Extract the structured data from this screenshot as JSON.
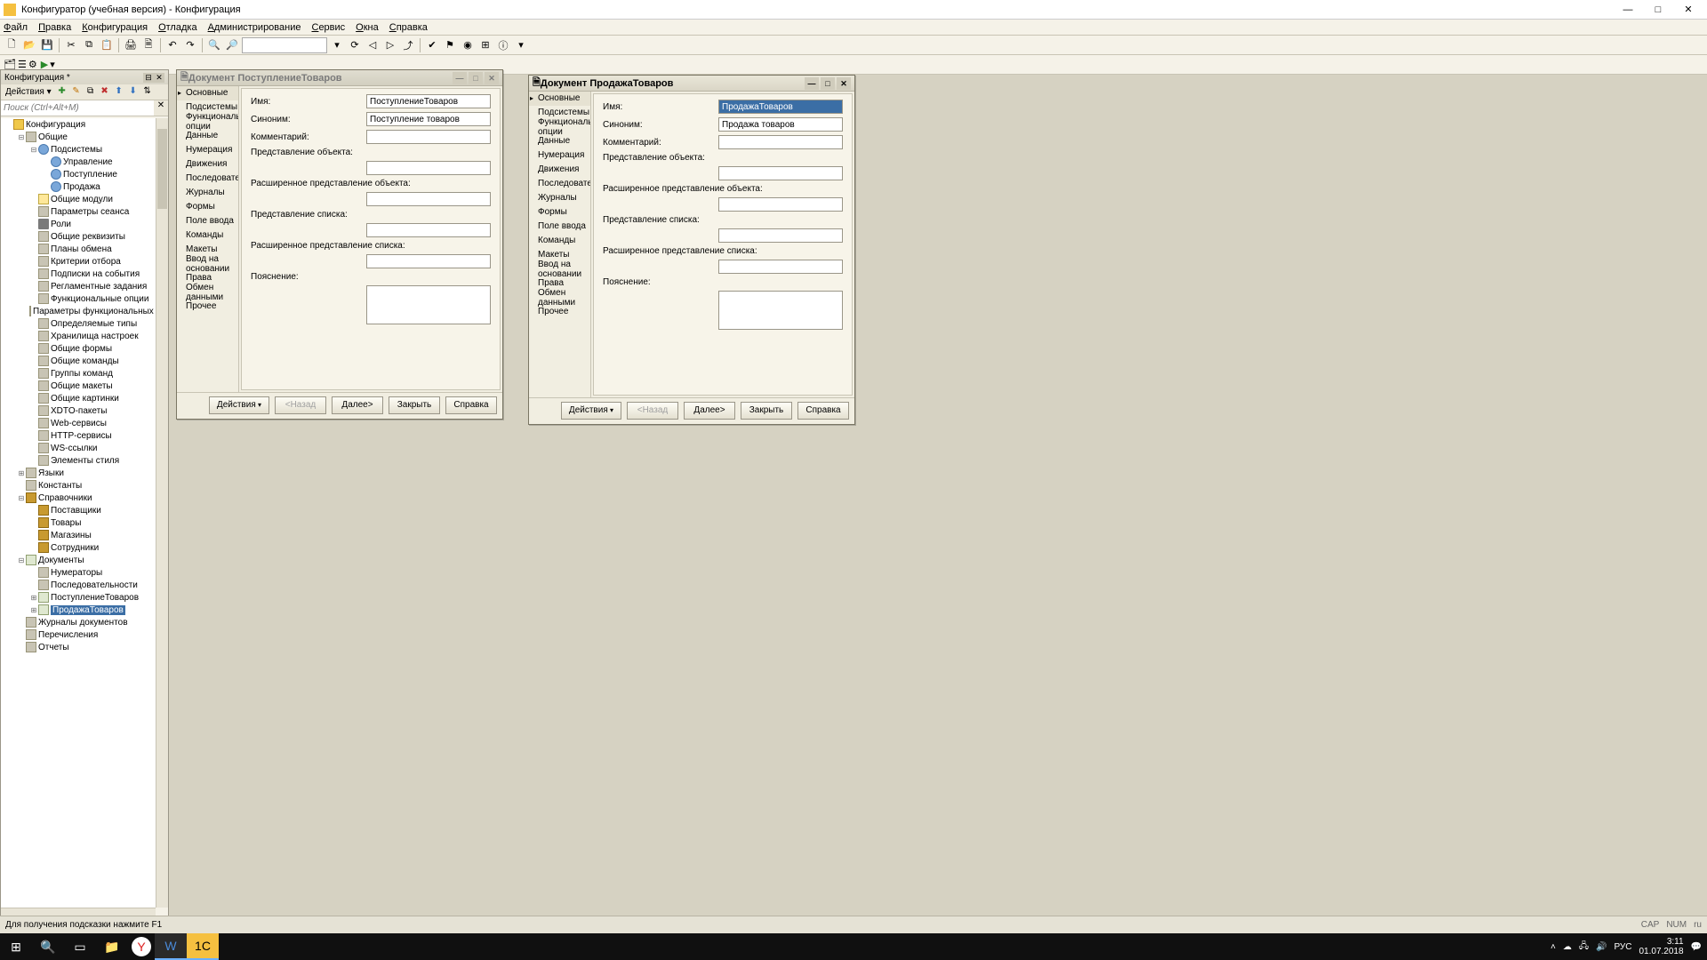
{
  "window": {
    "title": "Конфигуратор (учебная версия) - Конфигурация"
  },
  "menu": [
    "Файл",
    "Правка",
    "Конфигурация",
    "Отладка",
    "Администрирование",
    "Сервис",
    "Окна",
    "Справка"
  ],
  "tree_panel": {
    "title": "Конфигурация *",
    "actions_label": "Действия ▾",
    "search_placeholder": "Поиск (Ctrl+Alt+M)",
    "nodes": [
      {
        "d": 0,
        "exp": "",
        "ic": "ic-folder",
        "t": "Конфигурация"
      },
      {
        "d": 1,
        "exp": "⊟",
        "ic": "ic-gen",
        "t": "Общие"
      },
      {
        "d": 2,
        "exp": "⊟",
        "ic": "ic-sub",
        "t": "Подсистемы"
      },
      {
        "d": 3,
        "exp": "",
        "ic": "ic-sub",
        "t": "Управление"
      },
      {
        "d": 3,
        "exp": "",
        "ic": "ic-sub",
        "t": "Поступление"
      },
      {
        "d": 3,
        "exp": "",
        "ic": "ic-sub",
        "t": "Продажа"
      },
      {
        "d": 2,
        "exp": "",
        "ic": "ic-mod",
        "t": "Общие модули"
      },
      {
        "d": 2,
        "exp": "",
        "ic": "ic-gen",
        "t": "Параметры сеанса"
      },
      {
        "d": 2,
        "exp": "",
        "ic": "ic-role",
        "t": "Роли"
      },
      {
        "d": 2,
        "exp": "",
        "ic": "ic-gen",
        "t": "Общие реквизиты"
      },
      {
        "d": 2,
        "exp": "",
        "ic": "ic-gen",
        "t": "Планы обмена"
      },
      {
        "d": 2,
        "exp": "",
        "ic": "ic-gen",
        "t": "Критерии отбора"
      },
      {
        "d": 2,
        "exp": "",
        "ic": "ic-gen",
        "t": "Подписки на события"
      },
      {
        "d": 2,
        "exp": "",
        "ic": "ic-gen",
        "t": "Регламентные задания"
      },
      {
        "d": 2,
        "exp": "",
        "ic": "ic-gen",
        "t": "Функциональные опции"
      },
      {
        "d": 2,
        "exp": "",
        "ic": "ic-gen",
        "t": "Параметры функциональных опц"
      },
      {
        "d": 2,
        "exp": "",
        "ic": "ic-gen",
        "t": "Определяемые типы"
      },
      {
        "d": 2,
        "exp": "",
        "ic": "ic-gen",
        "t": "Хранилища настроек"
      },
      {
        "d": 2,
        "exp": "",
        "ic": "ic-gen",
        "t": "Общие формы"
      },
      {
        "d": 2,
        "exp": "",
        "ic": "ic-gen",
        "t": "Общие команды"
      },
      {
        "d": 2,
        "exp": "",
        "ic": "ic-gen",
        "t": "Группы команд"
      },
      {
        "d": 2,
        "exp": "",
        "ic": "ic-gen",
        "t": "Общие макеты"
      },
      {
        "d": 2,
        "exp": "",
        "ic": "ic-gen",
        "t": "Общие картинки"
      },
      {
        "d": 2,
        "exp": "",
        "ic": "ic-gen",
        "t": "XDTO-пакеты"
      },
      {
        "d": 2,
        "exp": "",
        "ic": "ic-gen",
        "t": "Web-сервисы"
      },
      {
        "d": 2,
        "exp": "",
        "ic": "ic-gen",
        "t": "HTTP-сервисы"
      },
      {
        "d": 2,
        "exp": "",
        "ic": "ic-gen",
        "t": "WS-ссылки"
      },
      {
        "d": 2,
        "exp": "",
        "ic": "ic-gen",
        "t": "Элементы стиля"
      },
      {
        "d": 1,
        "exp": "⊞",
        "ic": "ic-gen",
        "t": "Языки"
      },
      {
        "d": 1,
        "exp": "",
        "ic": "ic-gen",
        "t": "Константы"
      },
      {
        "d": 1,
        "exp": "⊟",
        "ic": "ic-cat",
        "t": "Справочники"
      },
      {
        "d": 2,
        "exp": "",
        "ic": "ic-cat",
        "t": "Поставщики"
      },
      {
        "d": 2,
        "exp": "",
        "ic": "ic-cat",
        "t": "Товары"
      },
      {
        "d": 2,
        "exp": "",
        "ic": "ic-cat",
        "t": "Магазины"
      },
      {
        "d": 2,
        "exp": "",
        "ic": "ic-cat",
        "t": "Сотрудники"
      },
      {
        "d": 1,
        "exp": "⊟",
        "ic": "ic-doc",
        "t": "Документы"
      },
      {
        "d": 2,
        "exp": "",
        "ic": "ic-gen",
        "t": "Нумераторы"
      },
      {
        "d": 2,
        "exp": "",
        "ic": "ic-gen",
        "t": "Последовательности"
      },
      {
        "d": 2,
        "exp": "⊞",
        "ic": "ic-doc",
        "t": "ПоступлениеТоваров"
      },
      {
        "d": 2,
        "exp": "⊞",
        "ic": "ic-doc",
        "t": "ПродажаТоваров",
        "sel": true
      },
      {
        "d": 1,
        "exp": "",
        "ic": "ic-gen",
        "t": "Журналы документов"
      },
      {
        "d": 1,
        "exp": "",
        "ic": "ic-gen",
        "t": "Перечисления"
      },
      {
        "d": 1,
        "exp": "",
        "ic": "ic-gen",
        "t": "Отчеты"
      }
    ]
  },
  "nav_items": [
    "Основные",
    "Подсистемы",
    "Функциональные опции",
    "Данные",
    "Нумерация",
    "Движения",
    "Последовательности",
    "Журналы",
    "Формы",
    "Поле ввода",
    "Команды",
    "Макеты",
    "Ввод на основании",
    "Права",
    "Обмен данными",
    "Прочее"
  ],
  "form_labels": {
    "name": "Имя:",
    "synonym": "Синоним:",
    "comment": "Комментарий:",
    "obj_repr": "Представление объекта:",
    "ext_obj_repr": "Расширенное представление объекта:",
    "list_repr": "Представление списка:",
    "ext_list_repr": "Расширенное представление списка:",
    "explain": "Пояснение:"
  },
  "win1": {
    "title": "Документ ПоступлениеТоваров",
    "name_val": "ПоступлениеТоваров",
    "syn_val": "Поступление товаров"
  },
  "win2": {
    "title": "Документ ПродажаТоваров",
    "name_val": "ПродажаТоваров",
    "syn_val": "Продажа товаров"
  },
  "buttons": {
    "actions": "Действия",
    "back": "<Назад",
    "next": "Далее>",
    "close": "Закрыть",
    "help": "Справка"
  },
  "wintabs": [
    "Документ ПоступлениеТов...",
    "Документ ПродажаТоваров"
  ],
  "status": {
    "hint": "Для получения подсказки нажмите F1",
    "cap": "CAP",
    "num": "NUM",
    "lang": "ru"
  },
  "tray": {
    "ime": "РУС",
    "time": "3:11",
    "date": "01.07.2018"
  }
}
